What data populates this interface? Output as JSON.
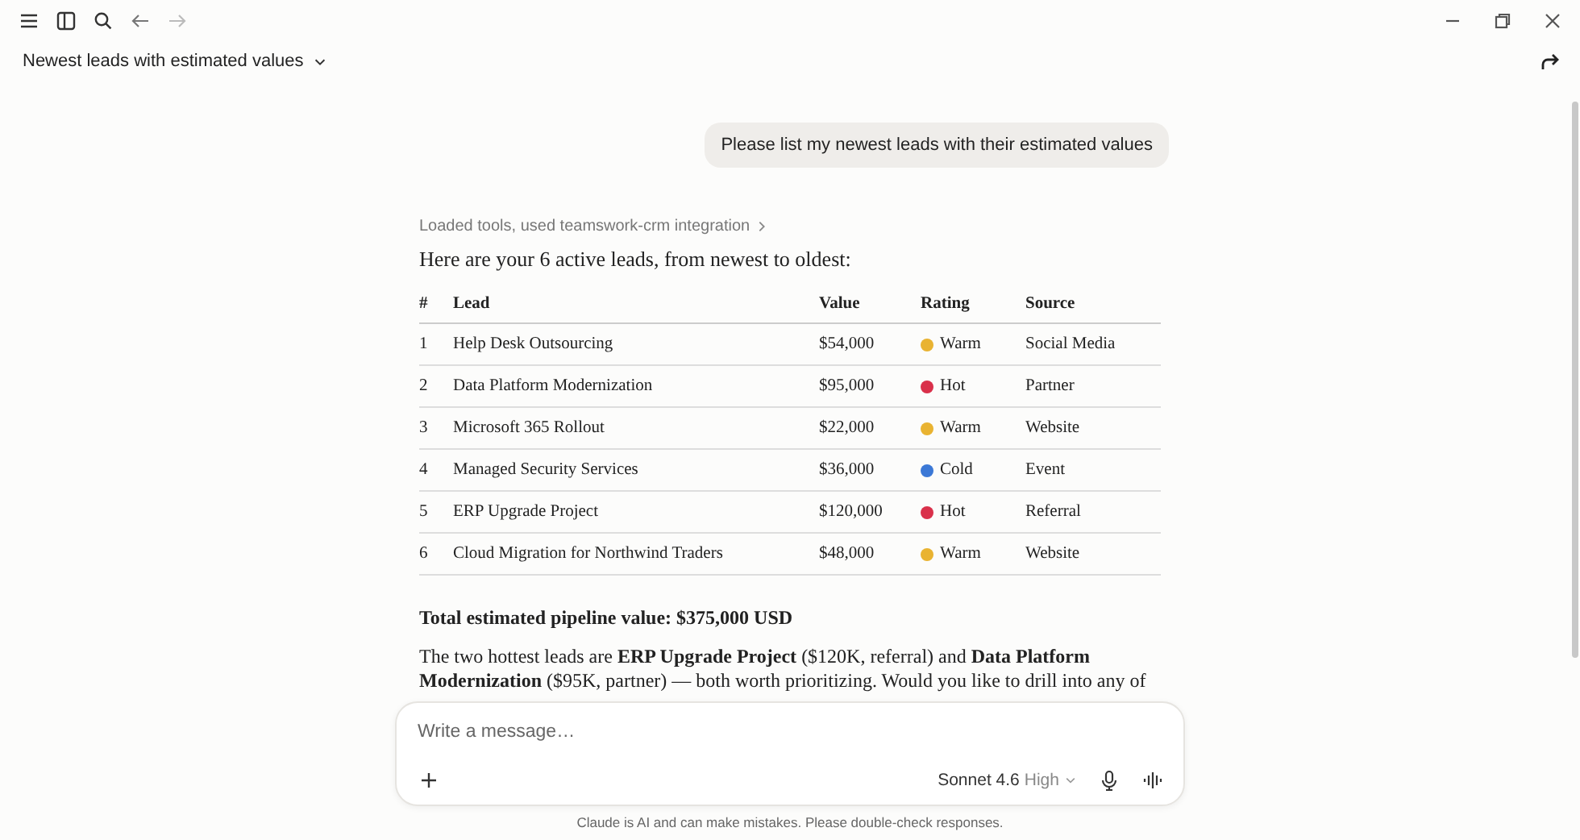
{
  "chat_title": "Newest leads with estimated values",
  "user_message": "Please list my newest leads with their estimated values",
  "tool_note": "Loaded tools, used teamswork-crm integration",
  "intro": "Here are your 6 active leads, from newest to oldest:",
  "table": {
    "columns": [
      "#",
      "Lead",
      "Value",
      "Rating",
      "Source"
    ],
    "rows": [
      {
        "num": "1",
        "lead": "Help Desk Outsourcing",
        "value": "$54,000",
        "rating": "Warm",
        "color": "#e9b331",
        "source": "Social Media"
      },
      {
        "num": "2",
        "lead": "Data Platform Modernization",
        "value": "$95,000",
        "rating": "Hot",
        "color": "#d9304a",
        "source": "Partner"
      },
      {
        "num": "3",
        "lead": "Microsoft 365 Rollout",
        "value": "$22,000",
        "rating": "Warm",
        "color": "#e9b331",
        "source": "Website"
      },
      {
        "num": "4",
        "lead": "Managed Security Services",
        "value": "$36,000",
        "rating": "Cold",
        "color": "#3b78d6",
        "source": "Event"
      },
      {
        "num": "5",
        "lead": "ERP Upgrade Project",
        "value": "$120,000",
        "rating": "Hot",
        "color": "#d9304a",
        "source": "Referral"
      },
      {
        "num": "6",
        "lead": "Cloud Migration for Northwind Traders",
        "value": "$48,000",
        "rating": "Warm",
        "color": "#e9b331",
        "source": "Website"
      }
    ]
  },
  "total": "Total estimated pipeline value: $375,000 USD",
  "summary": "The two hottest leads are **ERP Upgrade Project** ($120K, referral) and **Data Platform Modernization** ($95K, partner) — both worth prioritizing. Would you like to drill into any of",
  "composer": {
    "placeholder": "Write a message…",
    "model": "Sonnet 4.6",
    "effort": "High"
  },
  "disclaimer": "Claude is AI and can make mistakes. Please double-check responses."
}
